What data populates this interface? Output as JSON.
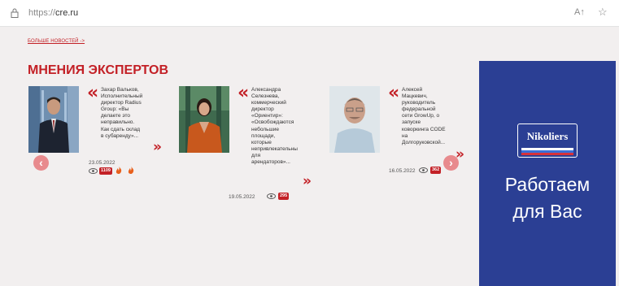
{
  "browser": {
    "url_scheme": "https://",
    "url_host": "cre.ru",
    "read_aloud": "A↑",
    "favorites": "☆"
  },
  "page": {
    "more_news": "БОЛЬШЕ НОВОСТЕЙ ->",
    "section_title": "МНЕНИЯ ЭКСПЕРТОВ"
  },
  "cards": [
    {
      "lines": [
        "Захар Вальков,",
        "Исполнительный",
        "директор Radius",
        "Group: «Вы",
        "делаете это",
        "неправильно.",
        "Как сдать склад",
        "в субаренду»..."
      ],
      "date": "23.05.2022",
      "views": "1109",
      "hot": true
    },
    {
      "lines": [
        "Александра",
        "Селезнева,",
        "коммерческий",
        "директор",
        "«Ориентир»:",
        "«Освобождаются",
        "небольшие",
        "площади,",
        "которые",
        "непривлекательны",
        "для",
        "арендаторов»..."
      ],
      "date": "19.05.2022",
      "views": "295",
      "hot": false
    },
    {
      "lines": [
        "Алексей",
        "Мацкевич,",
        "руководитель",
        "федеральной",
        "сети GrowUp, о",
        "запуске",
        "коворкинга CODE",
        "на",
        "Долгоруковской..."
      ],
      "date": "16.05.2022",
      "views": "362",
      "hot": false
    }
  ],
  "ad": {
    "brand": "Nikoliers",
    "line1": "Работаем",
    "line2": "для Вас"
  },
  "nav": {
    "prev": "‹",
    "next": "›"
  },
  "colors": {
    "accent": "#c32026",
    "ad_bg": "#2b3f94",
    "page_bg": "#f2efef"
  }
}
